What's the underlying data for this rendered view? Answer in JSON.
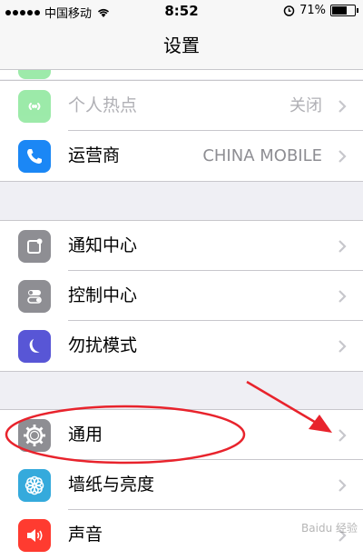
{
  "status_bar": {
    "carrier": "中国移动",
    "time": "8:52",
    "battery": "71%",
    "battery_level": 0.71
  },
  "navbar": {
    "title": "设置"
  },
  "groups": [
    {
      "rows": [
        {
          "label": "个人热点",
          "value": "关闭",
          "icon": "hotspot-icon",
          "color": "#4cd964"
        },
        {
          "label": "运营商",
          "value": "CHINA MOBILE",
          "icon": "phone-icon",
          "color": "#1b87f5"
        }
      ]
    },
    {
      "rows": [
        {
          "label": "通知中心",
          "icon": "notification-icon",
          "color": "#8e8e93"
        },
        {
          "label": "控制中心",
          "icon": "control-center-icon",
          "color": "#8e8e93"
        },
        {
          "label": "勿扰模式",
          "icon": "moon-icon",
          "color": "#5856d6"
        }
      ]
    },
    {
      "rows": [
        {
          "label": "通用",
          "icon": "gear-icon",
          "color": "#8e8e93"
        },
        {
          "label": "墙纸与亮度",
          "icon": "wallpaper-icon",
          "color": "#35aadc"
        },
        {
          "label": "声音",
          "icon": "speaker-icon",
          "color": "#ff3b30"
        }
      ]
    }
  ],
  "annotation_colors": {
    "ellipse": "#e8232c",
    "arrow": "#e8232c"
  }
}
